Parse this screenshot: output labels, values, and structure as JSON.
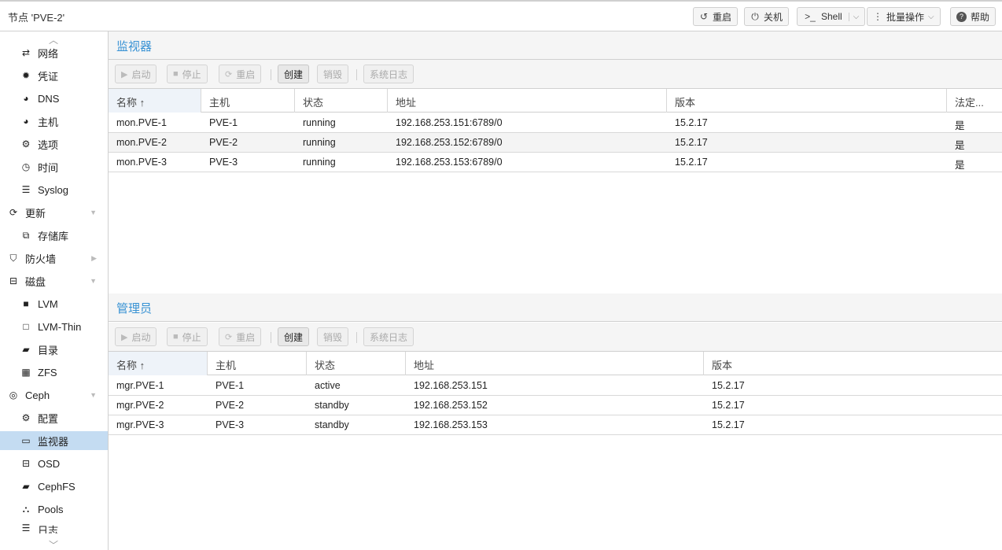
{
  "header": {
    "title": "节点 'PVE-2'",
    "buttons": {
      "reboot": "重启",
      "shutdown": "关机",
      "shell": "Shell",
      "bulk": "批量操作",
      "help": "帮助"
    }
  },
  "sidebar": {
    "items": [
      {
        "label": "网络",
        "icon": "network-icon"
      },
      {
        "label": "凭证",
        "icon": "certificate-icon"
      },
      {
        "label": "DNS",
        "icon": "globe-icon"
      },
      {
        "label": "主机",
        "icon": "globe-icon"
      },
      {
        "label": "选项",
        "icon": "gear-icon"
      },
      {
        "label": "时间",
        "icon": "clock-icon"
      },
      {
        "label": "Syslog",
        "icon": "list-icon"
      },
      {
        "label": "更新",
        "icon": "refresh-icon"
      },
      {
        "label": "存储库",
        "icon": "files-icon"
      },
      {
        "label": "防火墙",
        "icon": "shield-icon"
      },
      {
        "label": "磁盘",
        "icon": "drive-icon"
      },
      {
        "label": "LVM",
        "icon": "square-icon"
      },
      {
        "label": "LVM-Thin",
        "icon": "square-outline-icon"
      },
      {
        "label": "目录",
        "icon": "folder-icon"
      },
      {
        "label": "ZFS",
        "icon": "grid-icon"
      },
      {
        "label": "Ceph",
        "icon": "ceph-icon"
      },
      {
        "label": "配置",
        "icon": "gear-icon"
      },
      {
        "label": "监视器",
        "icon": "desktop-icon"
      },
      {
        "label": "OSD",
        "icon": "drive-icon"
      },
      {
        "label": "CephFS",
        "icon": "folder-icon"
      },
      {
        "label": "Pools",
        "icon": "sitemap-icon"
      },
      {
        "label": "日志",
        "icon": "list-icon"
      }
    ]
  },
  "toolbar": {
    "start": "启动",
    "stop": "停止",
    "restart": "重启",
    "create": "创建",
    "destroy": "销毁",
    "syslog": "系统日志"
  },
  "monitors": {
    "title": "监视器",
    "columns": [
      "名称 ↑",
      "主机",
      "状态",
      "地址",
      "版本",
      "法定..."
    ],
    "rows": [
      [
        "mon.PVE-1",
        "PVE-1",
        "running",
        "192.168.253.151:6789/0",
        "15.2.17",
        "是"
      ],
      [
        "mon.PVE-2",
        "PVE-2",
        "running",
        "192.168.253.152:6789/0",
        "15.2.17",
        "是"
      ],
      [
        "mon.PVE-3",
        "PVE-3",
        "running",
        "192.168.253.153:6789/0",
        "15.2.17",
        "是"
      ]
    ]
  },
  "managers": {
    "title": "管理员",
    "columns": [
      "名称 ↑",
      "主机",
      "状态",
      "地址",
      "版本"
    ],
    "rows": [
      [
        "mgr.PVE-1",
        "PVE-1",
        "active",
        "192.168.253.151",
        "15.2.17"
      ],
      [
        "mgr.PVE-2",
        "PVE-2",
        "standby",
        "192.168.253.152",
        "15.2.17"
      ],
      [
        "mgr.PVE-3",
        "PVE-3",
        "standby",
        "192.168.253.153",
        "15.2.17"
      ]
    ]
  }
}
